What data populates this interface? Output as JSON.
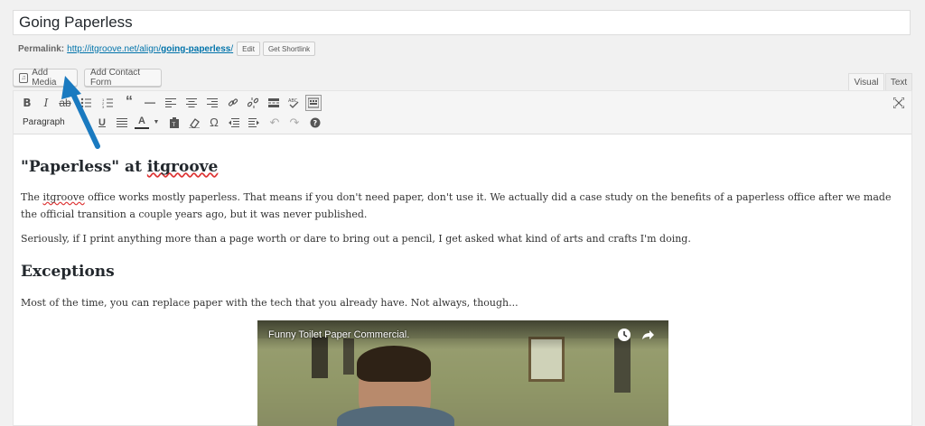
{
  "post": {
    "title": "Going Paperless",
    "permalink_label": "Permalink:",
    "permalink_base": "http://itgroove.net/align/",
    "permalink_slug": "going-paperless",
    "permalink_trail": "/",
    "edit_label": "Edit",
    "shortlink_label": "Get Shortlink"
  },
  "media_buttons": {
    "add_media": "Add Media",
    "add_contact_form": "Add Contact Form"
  },
  "editor_tabs": {
    "visual": "Visual",
    "text": "Text"
  },
  "toolbar": {
    "format_select": "Paragraph",
    "row1": [
      "bold",
      "italic",
      "strikethrough",
      "bullet-list",
      "numbered-list",
      "blockquote",
      "horizontal-rule",
      "align-left",
      "align-center",
      "align-right",
      "link",
      "unlink",
      "read-more",
      "spellcheck",
      "toolbar-toggle"
    ],
    "row2": [
      "underline",
      "justify",
      "text-color",
      "paste-as-text",
      "clear-formatting",
      "special-character",
      "outdent",
      "indent",
      "undo",
      "redo",
      "help"
    ]
  },
  "content": {
    "heading1_pre": "\"Paperless\" at ",
    "heading1_word": "itgroove",
    "para1_pre": "The ",
    "para1_word": "itgroove",
    "para1_rest": " office works mostly paperless. That means if you don't need paper, don't use it. We actually did a case study on the benefits of a paperless office after we made the official transition a couple years ago, but it was never published.",
    "para2": "Seriously, if I print anything more than a page worth or dare to bring out a pencil, I get asked what kind of arts and crafts I'm doing.",
    "heading2": "Exceptions",
    "para3": "Most of the time, you can replace paper with the tech that you already have. Not always, though..."
  },
  "video": {
    "title": "Funny Toilet Paper Commercial."
  },
  "colors": {
    "link": "#0073aa",
    "annotation_arrow": "#1a7ac0"
  }
}
